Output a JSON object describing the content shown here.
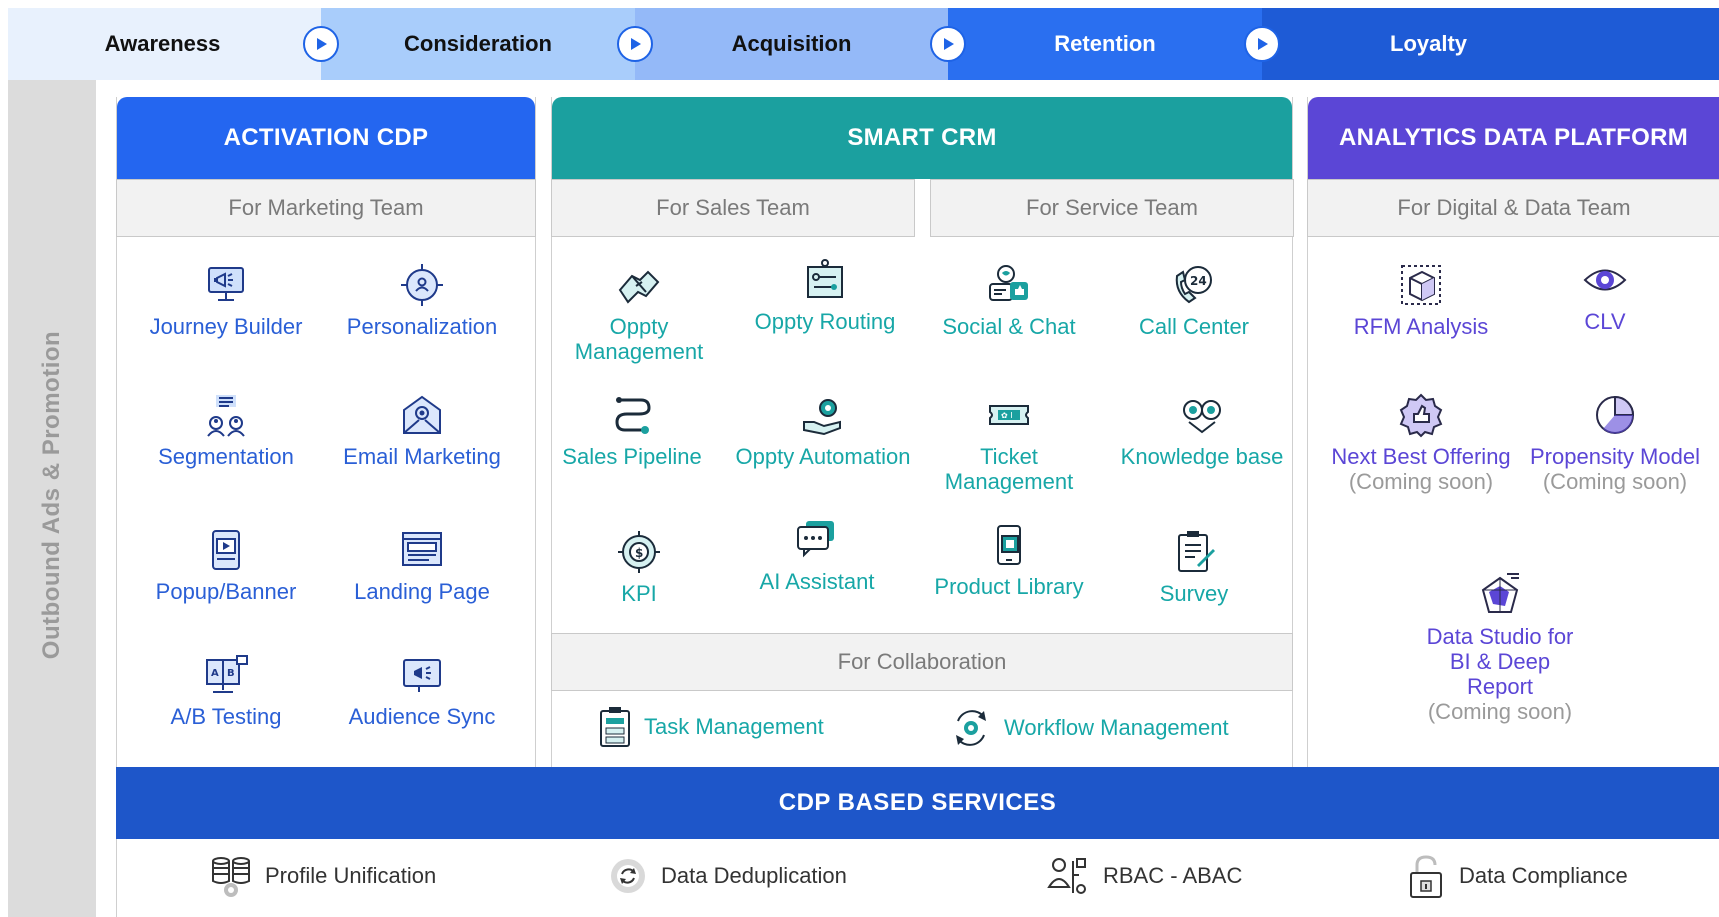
{
  "funnel": {
    "stages": [
      {
        "label": "Awareness",
        "bg": "#e8f1fd",
        "color": "#111111"
      },
      {
        "label": "Consideration",
        "bg": "#a9cdfb",
        "color": "#111111"
      },
      {
        "label": "Acquisition",
        "bg": "#94b9f8",
        "color": "#111111"
      },
      {
        "label": "Retention",
        "bg": "#2a6ff0",
        "color": "#ffffff"
      },
      {
        "label": "Loyalty",
        "bg": "#1e5bd6",
        "color": "#ffffff"
      }
    ]
  },
  "side_label": "Outbound Ads & Promotion",
  "activation": {
    "title": "ACTIVATION CDP",
    "header_color": "#2466f0",
    "subheader": "For Marketing Team",
    "items": [
      {
        "label": "Journey Builder",
        "icon": "megaphone-monitor-icon"
      },
      {
        "label": "Personalization",
        "icon": "target-user-icon"
      },
      {
        "label": "Segmentation",
        "icon": "user-group-list-icon"
      },
      {
        "label": "Email Marketing",
        "icon": "email-at-icon"
      },
      {
        "label": "Popup/Banner",
        "icon": "popup-device-icon"
      },
      {
        "label": "Landing Page",
        "icon": "landing-page-icon"
      },
      {
        "label": "A/B Testing",
        "icon": "ab-testing-icon"
      },
      {
        "label": "Audience Sync",
        "icon": "audience-sync-icon"
      }
    ]
  },
  "crm": {
    "title": "SMART CRM",
    "header_color": "#1ba09f",
    "sales_sub": "For Sales Team",
    "service_sub": "For Service Team",
    "sales_items": [
      {
        "label": "Oppty Management",
        "icon": "handshake-icon"
      },
      {
        "label": "Oppty Routing",
        "icon": "routing-board-icon"
      },
      {
        "label": "Sales Pipeline",
        "icon": "pipeline-icon"
      },
      {
        "label": "Oppty Automation",
        "icon": "automation-hand-icon"
      },
      {
        "label": "KPI",
        "icon": "kpi-target-icon"
      },
      {
        "label": "AI Assistant",
        "icon": "ai-chat-icon"
      }
    ],
    "service_items": [
      {
        "label": "Social & Chat",
        "icon": "social-chat-icon"
      },
      {
        "label": "Call Center",
        "icon": "call-center-24-icon"
      },
      {
        "label": "Ticket Management",
        "icon": "ticket-icon"
      },
      {
        "label": "Knowledge base",
        "icon": "knowledge-base-icon"
      },
      {
        "label": "Product Library",
        "icon": "product-library-icon"
      },
      {
        "label": "Survey",
        "icon": "survey-clipboard-icon"
      }
    ],
    "collab_sub": "For Collaboration",
    "collab_items": [
      {
        "label": "Task Management",
        "icon": "task-clipboard-icon"
      },
      {
        "label": "Workflow Management",
        "icon": "workflow-cycle-icon"
      }
    ]
  },
  "analytics": {
    "title": "ANALYTICS DATA PLATFORM",
    "header_color": "#5b46d6",
    "subheader": "For Digital & Data Team",
    "items": [
      {
        "label": "RFM Analysis",
        "note": "",
        "icon": "rfm-cube-icon"
      },
      {
        "label": "CLV",
        "note": "",
        "icon": "clv-eye-icon"
      },
      {
        "label": "Next Best Offering",
        "note": "(Coming soon)",
        "icon": "next-best-offering-icon"
      },
      {
        "label": "Propensity Model",
        "note": "(Coming soon)",
        "icon": "propensity-pie-icon"
      },
      {
        "label": "Data Studio for BI & Deep Report",
        "note": "(Coming soon)",
        "icon": "data-studio-radar-icon"
      }
    ]
  },
  "cdp_services": {
    "title": "CDP BASED SERVICES",
    "items": [
      {
        "label": "Profile Unification",
        "icon": "database-gear-icon"
      },
      {
        "label": "Data Deduplication",
        "icon": "dedup-gear-icon"
      },
      {
        "label": "RBAC - ABAC",
        "icon": "access-control-icon"
      },
      {
        "label": "Data Compliance",
        "icon": "padlock-icon"
      }
    ]
  }
}
